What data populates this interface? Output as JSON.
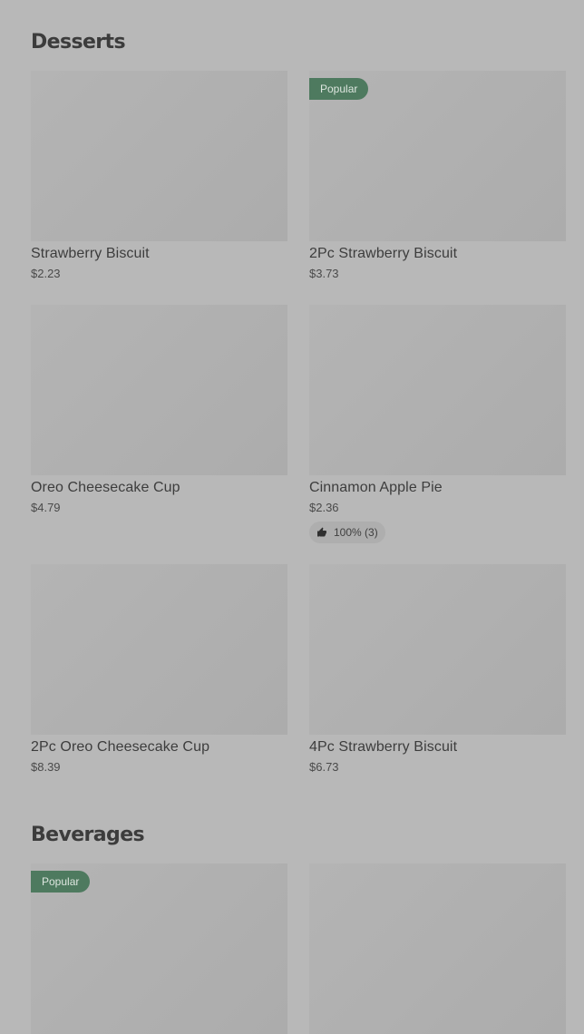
{
  "sections": [
    {
      "title": "Desserts",
      "items": [
        {
          "name": "Strawberry Biscuit",
          "price": "$2.23"
        },
        {
          "name": "2Pc Strawberry Biscuit",
          "price": "$3.73",
          "badge": "Popular"
        },
        {
          "name": "Oreo Cheesecake Cup",
          "price": "$4.79"
        },
        {
          "name": "Cinnamon Apple Pie",
          "price": "$2.36",
          "rating": "100% (3)"
        },
        {
          "name": "2Pc Oreo Cheesecake Cup",
          "price": "$8.39"
        },
        {
          "name": "4Pc Strawberry Biscuit",
          "price": "$6.73"
        }
      ]
    },
    {
      "title": "Beverages",
      "items": [
        {
          "badge": "Popular"
        },
        {}
      ]
    }
  ],
  "icons": {
    "rating": "thumbs-up-icon"
  },
  "colors": {
    "badge_bg": "#4e7a5f",
    "background": "#b8b8b8"
  }
}
